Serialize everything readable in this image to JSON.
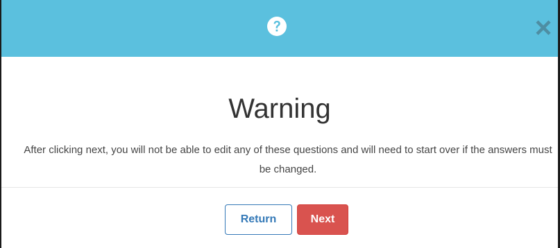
{
  "dialog": {
    "title": "Warning",
    "message": "After clicking next, you will not be able to edit any of these questions and will need to start over if the answers must be changed.",
    "header_icon": "question-circle-icon",
    "close_icon": "close-icon"
  },
  "buttons": {
    "return_label": "Return",
    "next_label": "Next"
  },
  "colors": {
    "header_bg": "#5bc0de",
    "return_border": "#3479b7",
    "next_bg": "#d9534f"
  }
}
